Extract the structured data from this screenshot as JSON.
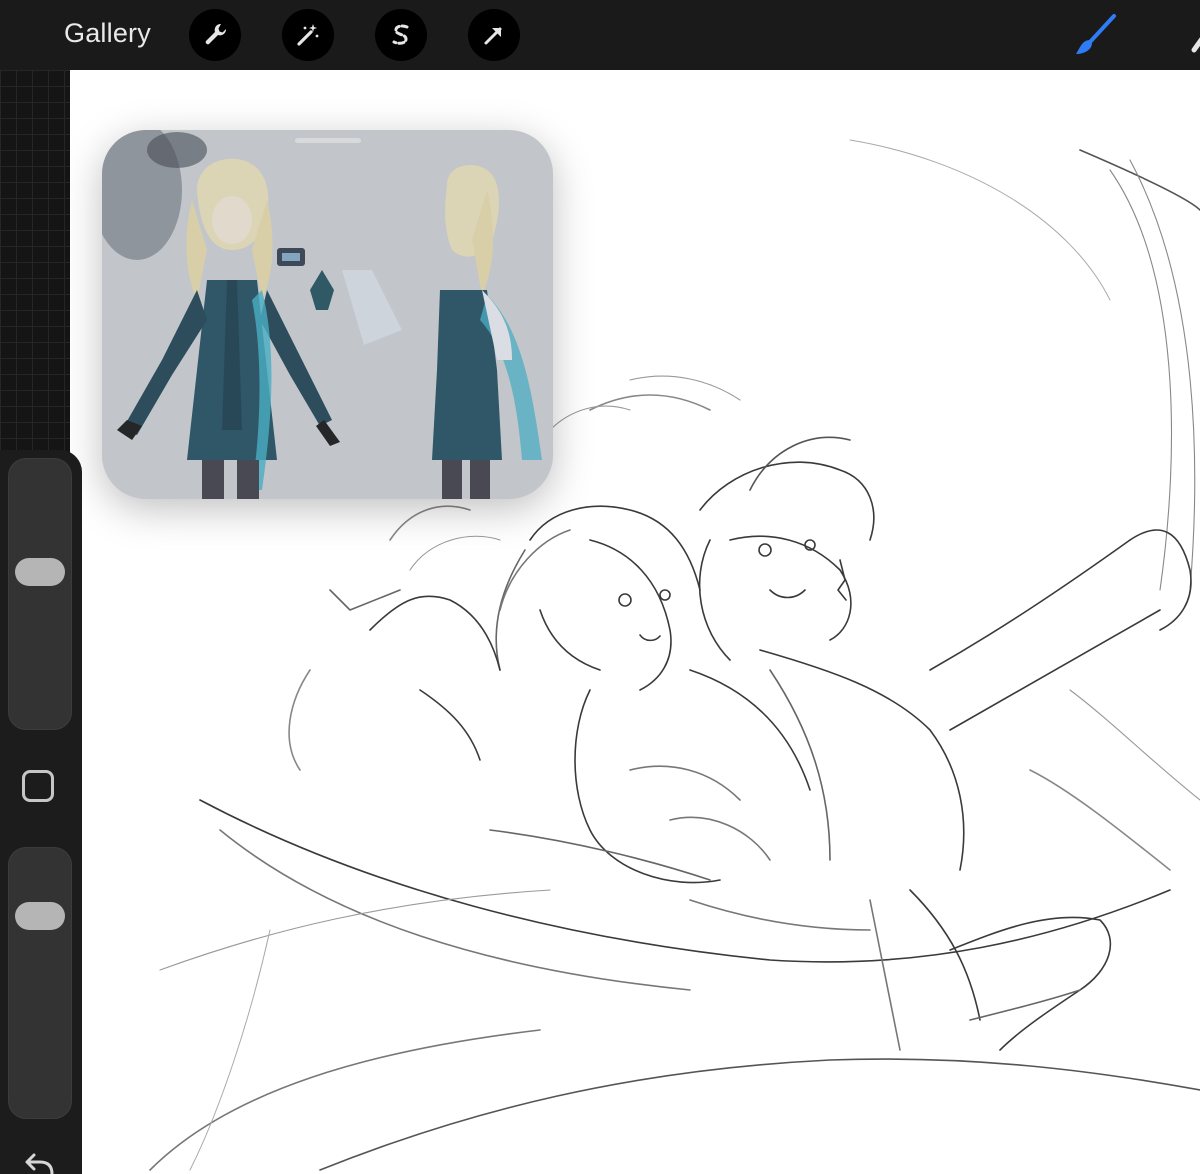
{
  "toolbar": {
    "gallery_label": "Gallery",
    "tools": [
      "wrench-icon",
      "magic-wand-icon",
      "selection-s-icon",
      "transform-arrow-icon"
    ],
    "brush_color": "#2e7cf6",
    "background_color": "#1a1a1a"
  },
  "sidebar": {
    "brush_size_level": 0.6,
    "opacity_level": 0.8
  },
  "reference": {
    "background_color": "#c9ccd1"
  }
}
